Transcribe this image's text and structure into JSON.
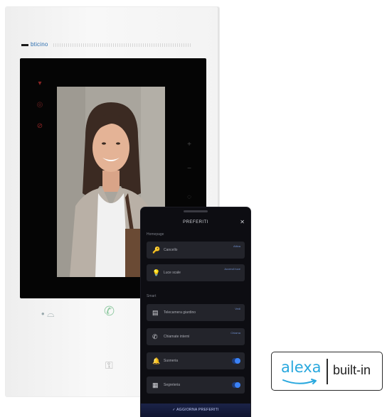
{
  "device": {
    "brand": "bticino"
  },
  "phone": {
    "title": "PREFERITI",
    "close": "✕",
    "section_1": "Homepage",
    "section_2": "Smart",
    "cards": [
      {
        "icon": "🔑",
        "label": "Cancello",
        "tag": "Attiva",
        "type": "tag"
      },
      {
        "icon": "💡",
        "label": "Luce scale",
        "tag": "Accendi luce",
        "type": "tag"
      },
      {
        "icon": "▤",
        "label": "Telecamera giardino",
        "tag": "Vedi",
        "type": "tag"
      },
      {
        "icon": "✆",
        "label": "Chiamate interni",
        "tag": "Chiama",
        "type": "tag"
      },
      {
        "icon": "🔔",
        "label": "Suoneria",
        "tag": "",
        "type": "toggle"
      },
      {
        "icon": "▦",
        "label": "Segreteria",
        "tag": "",
        "type": "toggle"
      }
    ],
    "action": "✓ AGGIORNA PREFERITI"
  },
  "badge": {
    "word": "alexa",
    "suffix": "built-in"
  },
  "colors": {
    "accent": "#3b82f6",
    "alexa_blue": "#29a8de",
    "brand_blue": "#2d6fb0"
  }
}
